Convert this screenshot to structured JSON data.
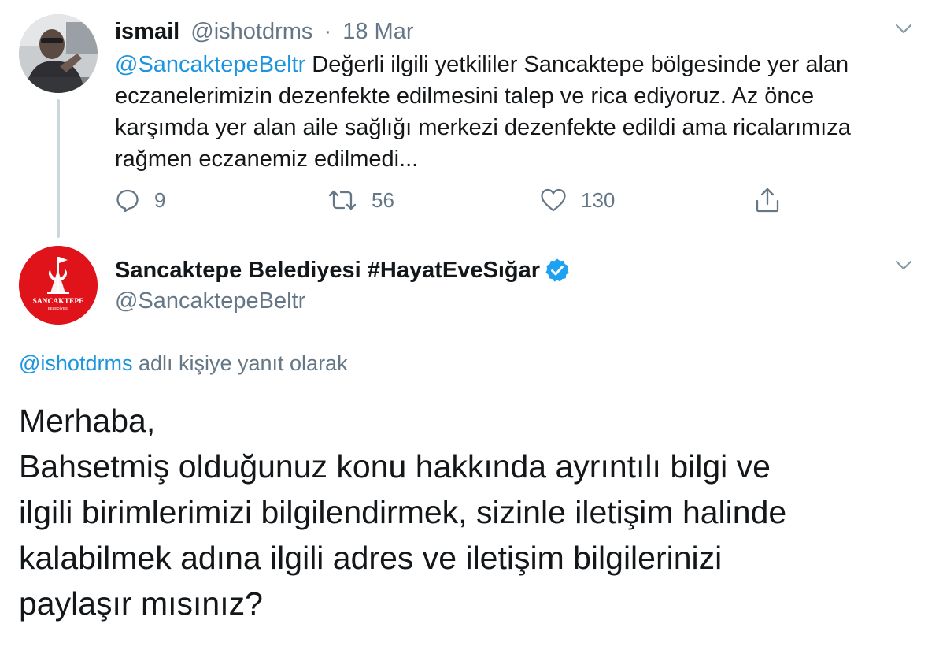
{
  "parent_tweet": {
    "author_name": "ismail",
    "handle": "@ishotdrms",
    "separator": "·",
    "date": "18 Mar",
    "mention": "@SancaktepeBeltr",
    "text": " Değerli ilgili yetkililer Sancaktepe bölgesinde yer alan eczanelerimizin dezenfekte edilmesini talep ve rica ediyoruz. Az önce karşımda yer alan aile sağlığı merkezi dezenfekte edildi ama ricalarımıza rağmen eczanemiz edilmedi...",
    "actions": {
      "reply_count": "9",
      "retweet_count": "56",
      "like_count": "130"
    }
  },
  "reply_tweet": {
    "author_name": "Sancaktepe Belediyesi #HayatEveSığar",
    "verified": true,
    "handle": "@SancaktepeBeltr",
    "avatar_text": "SANCAKTEPE",
    "avatar_subtext": "BELEDİYESİ",
    "replying_to_handle": "@ishotdrms",
    "replying_to_suffix": " adlı kişiye yanıt olarak",
    "text_lines": [
      "Merhaba,",
      "Bahsetmiş olduğunuz konu hakkında ayrıntılı bilgi ve",
      "ilgili birimlerimizi bilgilendirmek, sizinle iletişim halinde",
      "kalabilmek adına ilgili adres ve iletişim bilgilerinizi",
      "paylaşır mısınız?"
    ]
  },
  "colors": {
    "link": "#1b95e0",
    "muted": "#657786",
    "brand_red": "#e1131a",
    "thread_line": "#ccd6dd"
  },
  "icons": [
    "chevron-down-icon",
    "reply-icon",
    "retweet-icon",
    "like-icon",
    "share-icon",
    "verified-badge-icon"
  ]
}
